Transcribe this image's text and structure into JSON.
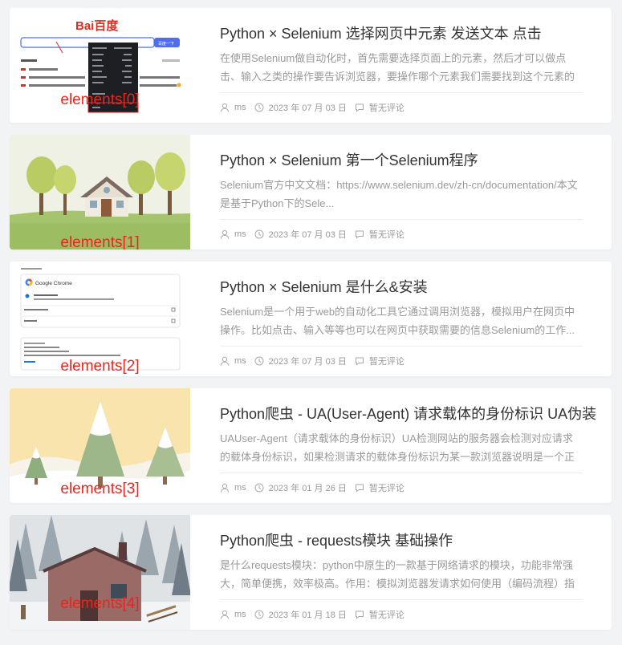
{
  "posts": [
    {
      "title": "Python × Selenium 选择网页中元素 发送文本 点击",
      "excerpt": "在使用Selenium做自动化时，首先需要选择页面上的元素，然后才可以做点击、输入之类的操作要告诉浏览器，要操作哪个元素我们需要找到这个元素的特征 以百度...",
      "author": "ms",
      "date": "2023 年 07 月 03 日",
      "comments": "暂无评论",
      "thumb_label": "elements[0]",
      "thumb_brand": "Bai百度",
      "thumb_button": "百度一下"
    },
    {
      "title": "Python × Selenium 第一个Selenium程序",
      "excerpt": "Selenium官方中文文档：https://www.selenium.dev/zh-cn/documentation/本文是基于Python下的Sele...",
      "author": "ms",
      "date": "2023 年 07 月 03 日",
      "comments": "暂无评论",
      "thumb_label": "elements[1]"
    },
    {
      "title": "Python × Selenium 是什么&安装",
      "excerpt": "Selenium是一个用于web的自动化工具它通过调用浏览器，模拟用户在网页中操作。比如点击、输入等等也可以在网页中获取需要的信息Selenium的工作...",
      "author": "ms",
      "date": "2023 年 07 月 03 日",
      "comments": "暂无评论",
      "thumb_label": "elements[2]",
      "thumb_app": "Google Chrome"
    },
    {
      "title": "Python爬虫 - UA(User-Agent) 请求载体的身份标识 UA伪装",
      "excerpt": "UAUser-Agent（请求载体的身份标识）UA检测网站的服务器会检测对应请求的载体身份标识，如果检测请求的载体身份标识为某一款浏览器说明是一个正常的请...",
      "author": "ms",
      "date": "2023 年 01 月 26 日",
      "comments": "暂无评论",
      "thumb_label": "elements[3]"
    },
    {
      "title": "Python爬虫 - requests模块 基础操作",
      "excerpt": "是什么requests模块：python中原生的一款基于网络请求的模块，功能非常强大，简单便携，效率极高。作用：模拟浏览器发请求如何使用（编码流程）指定u...",
      "author": "ms",
      "date": "2023 年 01 月 18 日",
      "comments": "暂无评论",
      "thumb_label": "elements[4]"
    }
  ],
  "colors": {
    "accent": "#e8261f",
    "title": "#333333",
    "muted": "#9a9a9a"
  },
  "icons": {
    "author": "user-icon",
    "date": "clock-icon",
    "comments": "comment-icon"
  }
}
